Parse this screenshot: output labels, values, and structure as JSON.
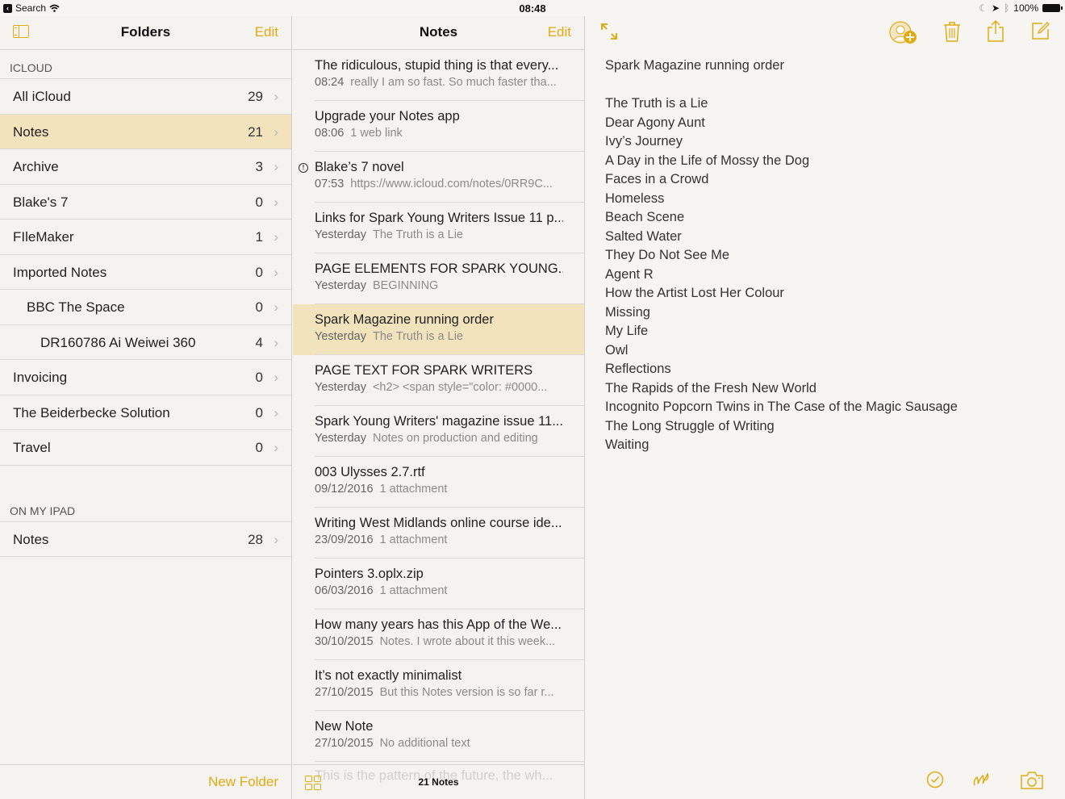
{
  "status_bar": {
    "back_app": "Search",
    "time": "08:48",
    "battery": "100%"
  },
  "colors": {
    "accent": "#e0ab14",
    "selection": "#f2e3bd"
  },
  "folders_pane": {
    "title": "Folders",
    "edit_label": "Edit",
    "new_folder_label": "New Folder",
    "sections": [
      {
        "header": "ICLOUD",
        "items": [
          {
            "name": "All iCloud",
            "count": "29",
            "indent": 0,
            "selected": false
          },
          {
            "name": "Notes",
            "count": "21",
            "indent": 0,
            "selected": true
          },
          {
            "name": "Archive",
            "count": "3",
            "indent": 0,
            "selected": false
          },
          {
            "name": "Blake's 7",
            "count": "0",
            "indent": 0,
            "selected": false
          },
          {
            "name": "FIleMaker",
            "count": "1",
            "indent": 0,
            "selected": false
          },
          {
            "name": "Imported Notes",
            "count": "0",
            "indent": 0,
            "selected": false
          },
          {
            "name": "BBC The Space",
            "count": "0",
            "indent": 1,
            "selected": false
          },
          {
            "name": "DR160786 Ai Weiwei 360",
            "count": "4",
            "indent": 2,
            "selected": false
          },
          {
            "name": "Invoicing",
            "count": "0",
            "indent": 0,
            "selected": false
          },
          {
            "name": "The Beiderbecke Solution",
            "count": "0",
            "indent": 0,
            "selected": false
          },
          {
            "name": "Travel",
            "count": "0",
            "indent": 0,
            "selected": false
          }
        ]
      },
      {
        "header": "ON MY IPAD",
        "items": [
          {
            "name": "Notes",
            "count": "28",
            "indent": 0,
            "selected": false
          }
        ]
      }
    ]
  },
  "notes_pane": {
    "title": "Notes",
    "edit_label": "Edit",
    "count_label": "21 Notes",
    "ghost_text": "This is the pattern of the future, the wh...",
    "notes": [
      {
        "title": "The ridiculous, stupid thing is that every...",
        "date": "08:24",
        "preview": "really I am so fast. So much faster tha...",
        "shared": false,
        "selected": false
      },
      {
        "title": "Upgrade your Notes app",
        "date": "08:06",
        "preview": "1 web link",
        "shared": false,
        "selected": false
      },
      {
        "title": "Blake’s 7 novel",
        "date": "07:53",
        "preview": "https://www.icloud.com/notes/0RR9C...",
        "shared": true,
        "selected": false
      },
      {
        "title": "Links for Spark Young Writers Issue 11 p...",
        "date": "Yesterday",
        "preview": "The Truth is a Lie",
        "shared": false,
        "selected": false
      },
      {
        "title": "PAGE ELEMENTS FOR SPARK YOUNG...",
        "date": "Yesterday",
        "preview": "BEGINNING",
        "shared": false,
        "selected": false
      },
      {
        "title": "Spark Magazine running order",
        "date": "Yesterday",
        "preview": "The Truth is a Lie",
        "shared": false,
        "selected": true
      },
      {
        "title": "PAGE TEXT FOR SPARK WRITERS",
        "date": "Yesterday",
        "preview": "<h2> <span style=\"color: #0000...",
        "shared": false,
        "selected": false
      },
      {
        "title": "Spark Young Writers' magazine issue 11...",
        "date": "Yesterday",
        "preview": "Notes on production and editing",
        "shared": false,
        "selected": false
      },
      {
        "title": "003 Ulysses 2.7.rtf",
        "date": "09/12/2016",
        "preview": "1 attachment",
        "shared": false,
        "selected": false
      },
      {
        "title": "Writing West Midlands online course ide...",
        "date": "23/09/2016",
        "preview": "1 attachment",
        "shared": false,
        "selected": false
      },
      {
        "title": "Pointers 3.oplx.zip",
        "date": "06/03/2016",
        "preview": "1 attachment",
        "shared": false,
        "selected": false
      },
      {
        "title": "How many years has this App of the We...",
        "date": "30/10/2015",
        "preview": "Notes. I wrote about it this week...",
        "shared": false,
        "selected": false
      },
      {
        "title": "It’s not exactly minimalist",
        "date": "27/10/2015",
        "preview": "But this Notes version is so far r...",
        "shared": false,
        "selected": false
      },
      {
        "title": "New Note",
        "date": "27/10/2015",
        "preview": "No additional text",
        "shared": false,
        "selected": false
      }
    ]
  },
  "editor": {
    "toolbar_icons": [
      "expand-icon",
      "add-person-icon",
      "trash-icon",
      "share-icon",
      "compose-icon"
    ],
    "bottom_icons": [
      "checklist-icon",
      "sketch-icon",
      "camera-icon"
    ],
    "lines": [
      "Spark Magazine running order",
      "",
      "The Truth is a Lie",
      "Dear Agony Aunt",
      "Ivy’s Journey",
      "A Day in the Life of Mossy the Dog",
      "Faces in a Crowd",
      "Homeless",
      "Beach Scene",
      "Salted Water",
      "They Do Not See Me",
      "Agent R",
      "How the Artist Lost Her Colour",
      "Missing",
      "My Life",
      "Owl",
      "Reflections",
      "The Rapids of the Fresh New World",
      "Incognito Popcorn Twins in The Case of the Magic Sausage",
      "The Long Struggle of Writing",
      "Waiting"
    ]
  }
}
